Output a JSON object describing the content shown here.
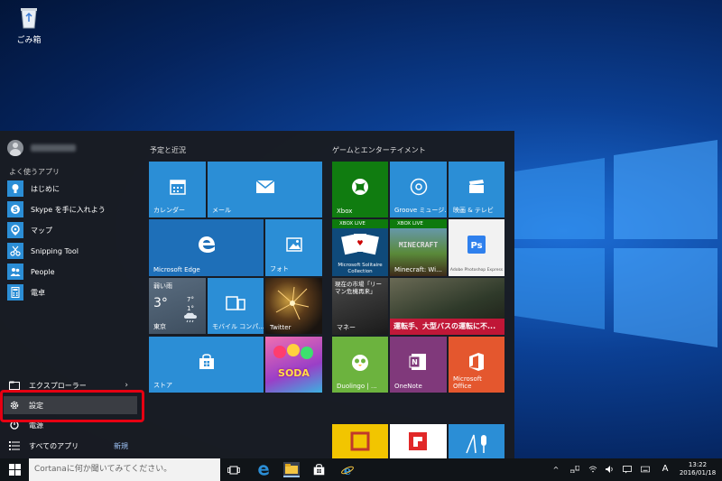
{
  "desktop": {
    "recycle_bin_label": "ごみ箱"
  },
  "start_menu": {
    "section_label": "よく使うアプリ",
    "apps": [
      {
        "label": "はじめに",
        "icon": "lightbulb-icon"
      },
      {
        "label": "Skype を手に入れよう",
        "icon": "skype-icon"
      },
      {
        "label": "マップ",
        "icon": "maps-icon"
      },
      {
        "label": "Snipping Tool",
        "icon": "scissors-icon"
      },
      {
        "label": "People",
        "icon": "people-icon"
      },
      {
        "label": "電卓",
        "icon": "calculator-icon"
      }
    ],
    "bottom": {
      "explorer": "エクスプローラー",
      "settings": "設定",
      "power": "電源",
      "all_apps": "すべてのアプリ",
      "new": "新規"
    },
    "groups": {
      "left_title": "予定と近況",
      "right_title": "ゲームとエンターテイメント"
    },
    "tiles": {
      "calendar": "カレンダー",
      "mail": "メール",
      "edge": "Microsoft Edge",
      "photos": "フォト",
      "weather_cond": "弱い雨",
      "weather_temp": "3°",
      "weather_hi": "7°",
      "weather_lo": "1°",
      "weather_city": "東京",
      "mobile": "モバイル コンパ...",
      "twitter": "Twitter",
      "store": "ストア",
      "candy_crush": "SODA",
      "xbox": "Xbox",
      "groove": "Groove ミュージ...",
      "movies": "映画 & テレビ",
      "xbox_live_1": "XBOX LIVE",
      "xbox_live_2": "XBOX LIVE",
      "solitaire": "Microsoft Solitaire Collection",
      "minecraft": "Minecraft: Wi...",
      "ps_express": "Adobe Photoshop Express",
      "money_headline": "現在の市場「リーマン危機再来」",
      "money": "マネー",
      "news_headline": "運転手、大型バスの運転に不...",
      "duolingo": "Duolingo | ...",
      "onenote": "OneNote",
      "office": "Microsoft Office"
    }
  },
  "taskbar": {
    "search_placeholder": "Cortanaに何か聞いてみてください。",
    "ime": "A",
    "time": "13:22",
    "date": "2016/01/18"
  },
  "colors": {
    "tile_blue": "#2b8ed6",
    "tile_blue_dark": "#1e6fb8",
    "xbox_green": "#107c10",
    "duolingo_green": "#6cb33e",
    "onenote_purple": "#80397b",
    "office_orange": "#e4572e",
    "highlight_red": "#e60012"
  }
}
